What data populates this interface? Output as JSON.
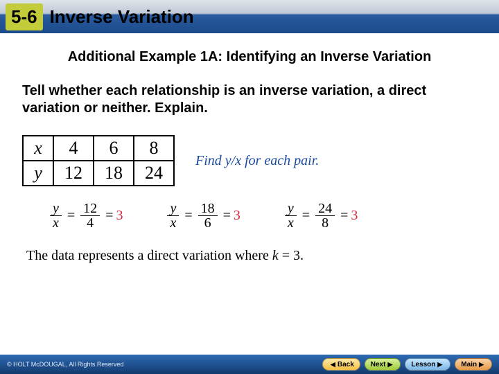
{
  "header": {
    "section_number": "5-6",
    "section_title": "Inverse Variation"
  },
  "example_title": "Additional Example 1A: Identifying an Inverse Variation",
  "instruction": "Tell whether each relationship is an inverse variation, a direct variation or neither. Explain.",
  "table": {
    "x_label": "x",
    "y_label": "y",
    "x": [
      "4",
      "6",
      "8"
    ],
    "y": [
      "12",
      "18",
      "24"
    ]
  },
  "hint": "Find y/x for each pair.",
  "calc": {
    "ylabel": "y",
    "xlabel": "x",
    "pairs": [
      {
        "num": "12",
        "den": "4",
        "res": "3"
      },
      {
        "num": "18",
        "den": "6",
        "res": "3"
      },
      {
        "num": "24",
        "den": "8",
        "res": "3"
      }
    ]
  },
  "conclusion_pre": "The data represents a direct variation where ",
  "conclusion_k": "k",
  "conclusion_post": " = 3.",
  "footer": {
    "copyright": "© HOLT McDOUGAL, All Rights Reserved",
    "back": "Back",
    "next": "Next",
    "lesson": "Lesson",
    "main": "Main"
  }
}
